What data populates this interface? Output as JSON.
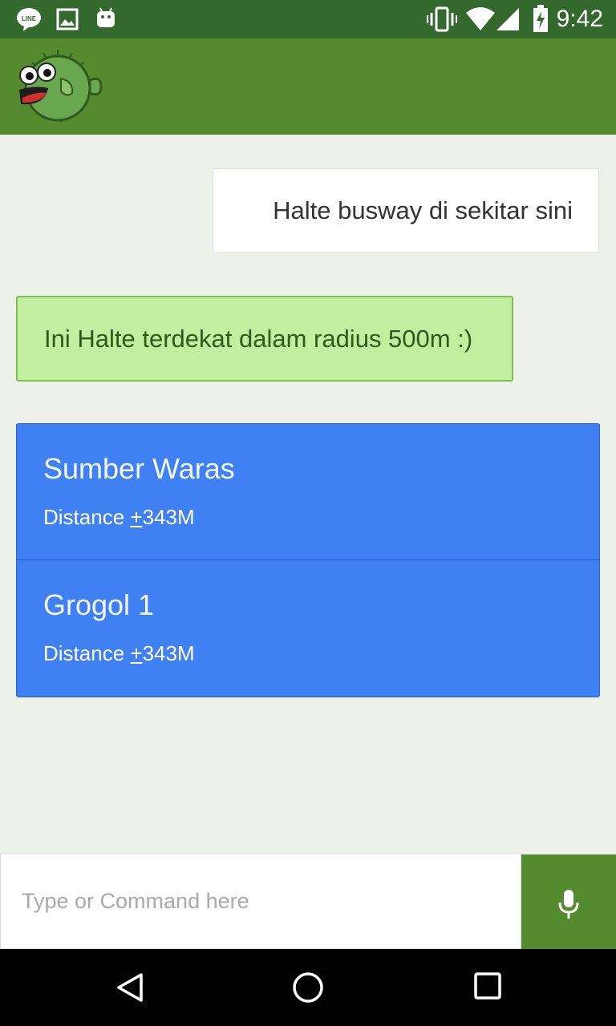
{
  "status_bar": {
    "time": "9:42",
    "left_icons": [
      "line-icon",
      "image-icon",
      "android-icon"
    ],
    "right_icons": [
      "vibrate-icon",
      "wifi-icon",
      "signal-icon",
      "battery-charging-icon"
    ]
  },
  "app_bar": {
    "logo_icon": "pufferfish-logo-icon",
    "color": "#558b2f"
  },
  "chat": {
    "user_message": "Halte busway di sekitar sini",
    "bot_message": "Ini Halte terdekat dalam radius 500m :)",
    "stops": [
      {
        "name": "Sumber Waras",
        "distance_label": "Distance ",
        "distance_sign": "+",
        "distance_value": "343M"
      },
      {
        "name": "Grogol 1",
        "distance_label": "Distance ",
        "distance_sign": "+",
        "distance_value": "343M"
      }
    ]
  },
  "input": {
    "placeholder": "Type or Command here",
    "value": "",
    "mic_icon": "microphone-icon"
  },
  "nav_bar": {
    "buttons": [
      "back-icon",
      "home-icon",
      "recents-icon"
    ]
  },
  "colors": {
    "status_bar": "#33692c",
    "app_bar": "#558b2f",
    "bot_bubble": "#c2eea0",
    "stop_card": "#3f80f3",
    "background": "#edf1ea"
  }
}
